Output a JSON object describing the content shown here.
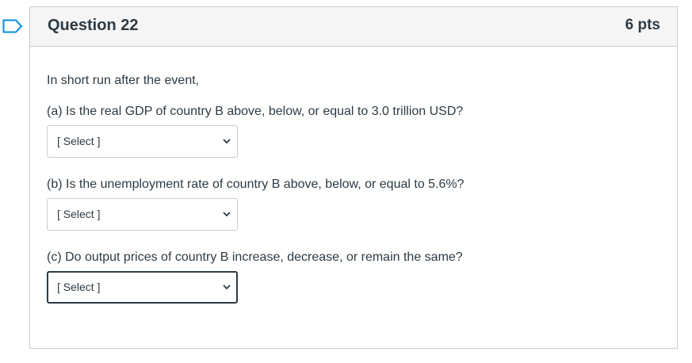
{
  "question": {
    "title": "Question 22",
    "points": "6 pts",
    "intro": "In short run after the event,",
    "parts": [
      {
        "prompt": "(a) Is the real GDP of country B above, below, or equal to 3.0 trillion USD?",
        "select_value": "[ Select ]"
      },
      {
        "prompt": "(b) Is the unemployment rate of country B above, below, or equal to 5.6%?",
        "select_value": "[ Select ]"
      },
      {
        "prompt": "(c) Do output prices of country B increase, decrease, or remain the same?",
        "select_value": "[ Select ]"
      }
    ]
  },
  "icons": {
    "flag": "bookmark-flag-icon",
    "dropdown": "chevron-down-icon"
  },
  "colors": {
    "flag_blue": "#008ee2",
    "text": "#2d3b45",
    "border": "#c7cdd1",
    "header_bg": "#f5f5f5"
  }
}
